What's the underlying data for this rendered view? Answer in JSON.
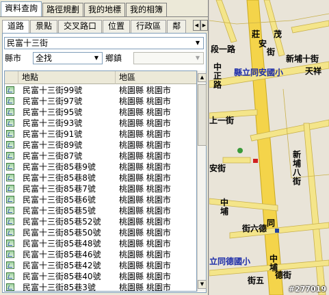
{
  "top_tabs": [
    "資料查詢",
    "路徑規劃",
    "我的地標",
    "我的相簿"
  ],
  "sub_tabs": [
    "道路",
    "景點",
    "交叉路口",
    "位置",
    "行政區",
    "鄰"
  ],
  "search": {
    "road_value": "民富十三街"
  },
  "filters": {
    "county_label": "縣市",
    "county_value": "全找",
    "town_label": "鄉鎮",
    "town_value": ""
  },
  "table": {
    "headers": [
      "地點",
      "地區"
    ],
    "rows": [
      [
        "民富十三街99號",
        "桃園縣 桃園市"
      ],
      [
        "民富十三街97號",
        "桃園縣 桃園市"
      ],
      [
        "民富十三街95號",
        "桃園縣 桃園市"
      ],
      [
        "民富十三街93號",
        "桃園縣 桃園市"
      ],
      [
        "民富十三街91號",
        "桃園縣 桃園市"
      ],
      [
        "民富十三街89號",
        "桃園縣 桃園市"
      ],
      [
        "民富十三街87號",
        "桃園縣 桃園市"
      ],
      [
        "民富十三街85巷9號",
        "桃園縣 桃園市"
      ],
      [
        "民富十三街85巷8號",
        "桃園縣 桃園市"
      ],
      [
        "民富十三街85巷7號",
        "桃園縣 桃園市"
      ],
      [
        "民富十三街85巷6號",
        "桃園縣 桃園市"
      ],
      [
        "民富十三街85巷5號",
        "桃園縣 桃園市"
      ],
      [
        "民富十三街85巷52號",
        "桃園縣 桃園市"
      ],
      [
        "民富十三街85巷50號",
        "桃園縣 桃園市"
      ],
      [
        "民富十三街85巷48號",
        "桃園縣 桃園市"
      ],
      [
        "民富十三街85巷46號",
        "桃園縣 桃園市"
      ],
      [
        "民富十三街85巷42號",
        "桃園縣 桃園市"
      ],
      [
        "民富十三街85巷40號",
        "桃園縣 桃園市"
      ],
      [
        "民富十三街85巷3號",
        "桃園縣 桃園市"
      ]
    ]
  },
  "map": {
    "labels": {
      "road1": "段一路",
      "road_an": "安",
      "road_kai": "莊",
      "road_mao": "茂",
      "road_street": "街",
      "xinpu": "新埔十街",
      "school1": "縣立同安國小",
      "tianxiang": "天祥",
      "zhongzheng": "中正路",
      "road_jie": "上一街",
      "an_street": "安街",
      "xinpu_ba": "新埔八街",
      "zhongpu": "中埔",
      "liude": "街六德",
      "tong": "同",
      "school2": "立同德國小",
      "zhongpu2": "中埔",
      "five": "街五",
      "de_street": "德街"
    },
    "watermark": "#277019"
  }
}
